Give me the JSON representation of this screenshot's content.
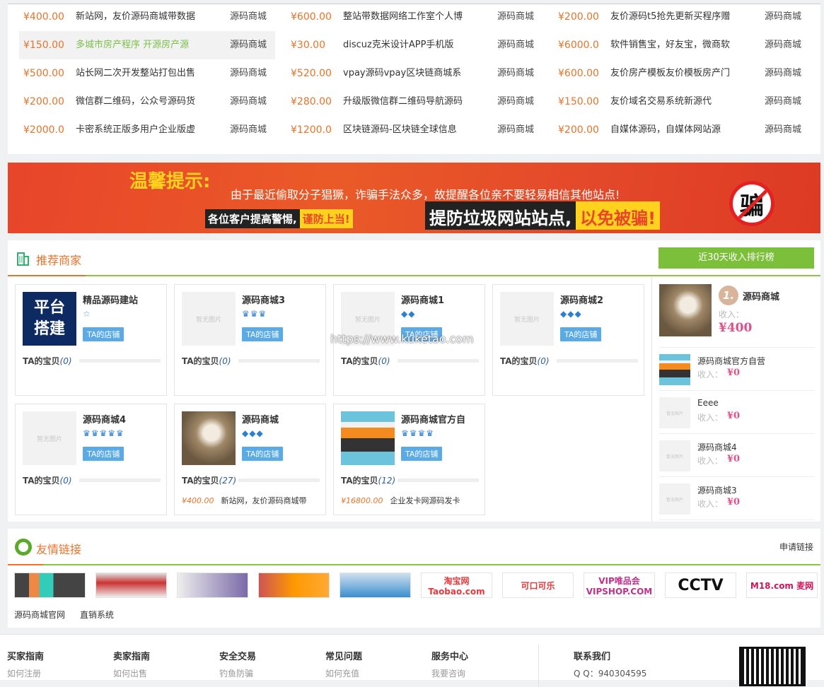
{
  "toplist": {
    "columns": [
      [
        {
          "price": "¥400.00",
          "title": "新站网，友价源码商城带数据",
          "shop": "源码商城"
        },
        {
          "price": "¥150.00",
          "title": "多城市房产程序 开源房产源",
          "shop": "源码商城",
          "highlight": true
        },
        {
          "price": "¥500.00",
          "title": "站长网二次开发整站打包出售",
          "shop": "源码商城"
        },
        {
          "price": "¥200.00",
          "title": "微信群二维码，公众号源码货",
          "shop": "源码商城"
        },
        {
          "price": "¥2000.0",
          "title": "卡密系统正版多用户企业版虚",
          "shop": "源码商城"
        }
      ],
      [
        {
          "price": "¥600.00",
          "title": "整站带数据网络工作室个人博",
          "shop": "源码商城"
        },
        {
          "price": "¥30.00",
          "title": "discuz克米设计APP手机版",
          "shop": "源码商城"
        },
        {
          "price": "¥520.00",
          "title": "vpay源码vpay区块链商城系",
          "shop": "源码商城"
        },
        {
          "price": "¥280.00",
          "title": "升级版微信群二维码导航源码",
          "shop": "源码商城"
        },
        {
          "price": "¥1200.0",
          "title": "区块链源码-区块链全球信息",
          "shop": "源码商城"
        }
      ],
      [
        {
          "price": "¥200.00",
          "title": "友价源码t5抢先更新买程序赠",
          "shop": "源码商城"
        },
        {
          "price": "¥6000.0",
          "title": "软件销售宝，好友宝，微商软",
          "shop": "源码商城"
        },
        {
          "price": "¥600.00",
          "title": "友价房产模板友价模板房产门",
          "shop": "源码商城"
        },
        {
          "price": "¥150.00",
          "title": "友价域名交易系统新源代",
          "shop": "源码商城"
        },
        {
          "price": "¥200.00",
          "title": "自媒体源码，自媒体网站源",
          "shop": "源码商城"
        }
      ]
    ]
  },
  "banner": {
    "heading": "温馨提示:",
    "line1": "由于最近偷取分子猖獗，诈骗手法众多，故提醒各位亲不要轻易相信其他站点!",
    "badge1_a": "各位客户提高警惕,",
    "badge1_b": "谨防上当!",
    "badge2_a": "提防垃圾网站站点,",
    "badge2_b": "以免被骗!",
    "icon_text": "骗"
  },
  "recommend": {
    "title": "推荐商家",
    "ranking_button": "近30天收入排行榜",
    "watermark": "https://www.kuketao.com",
    "cards": [
      {
        "name": "精品源码建站",
        "rank": "☆",
        "shop_btn": "TA的店铺",
        "goods_label": "TA的宝贝",
        "goods_count": "(0)",
        "thumb": "platform",
        "thumb_text": "平台搭建"
      },
      {
        "name": "源码商城3",
        "rank": "♛♛♛",
        "shop_btn": "TA的店铺",
        "goods_label": "TA的宝贝",
        "goods_count": "(0)",
        "thumb_text": "暂无图片"
      },
      {
        "name": "源码商城1",
        "rank": "◆◆",
        "shop_btn": "TA的店铺",
        "goods_label": "TA的宝贝",
        "goods_count": "(0)",
        "thumb_text": "暂无图片"
      },
      {
        "name": "源码商城2",
        "rank": "◆◆◆",
        "shop_btn": "TA的店铺",
        "goods_label": "TA的宝贝",
        "goods_count": "(0)",
        "thumb_text": "暂无图片"
      },
      {
        "name": "源码商城4",
        "rank": "♛♛♛♛♛",
        "shop_btn": "TA的店铺",
        "goods_label": "TA的宝贝",
        "goods_count": "(0)",
        "thumb_text": "暂无图片"
      },
      {
        "name": "源码商城",
        "rank": "◆◆◆",
        "shop_btn": "TA的店铺",
        "goods_label": "TA的宝贝",
        "goods_count": "(27)",
        "thumb": "photo",
        "item_price": "¥400.00",
        "item_title": "新站网，友价源码商城带"
      },
      {
        "name": "源码商城官方自",
        "rank": "♛♛♛♛",
        "shop_btn": "TA的店铺",
        "goods_label": "TA的宝贝",
        "goods_count": "(12)",
        "thumb": "screen",
        "item_price": "¥16800.00",
        "item_title": "企业发卡网源码发卡"
      }
    ],
    "ranking": [
      {
        "rank": "1.",
        "name": "源码商城",
        "income_label": "收入：",
        "income": "¥400",
        "thumb": "photo"
      },
      {
        "name": "源码商城官方自营",
        "income_label": "收入：",
        "income": "¥0",
        "thumb": "screen"
      },
      {
        "name": "Eeee",
        "income_label": "收入：",
        "income": "¥0",
        "thumb_text": "暂无图片"
      },
      {
        "name": "源码商城4",
        "income_label": "收入：",
        "income": "¥0",
        "thumb_text": "暂无图片"
      },
      {
        "name": "源码商城3",
        "income_label": "收入：",
        "income": "¥0",
        "thumb_text": "暂无图片"
      }
    ]
  },
  "links": {
    "title": "友情链接",
    "apply": "申请链接",
    "logos": [
      "淘宝网 Taobao.com",
      "可口可乐",
      "VIP唯品会 VIPSHOP.COM",
      "CCTV",
      "M18.com 麦网"
    ],
    "text_links": [
      "源码商城官网",
      "直销系统"
    ]
  },
  "footer": {
    "columns": [
      {
        "head": "买家指南",
        "link": "如何注册"
      },
      {
        "head": "卖家指南",
        "link": "如何出售"
      },
      {
        "head": "安全交易",
        "link": "钓鱼防骗"
      },
      {
        "head": "常见问题",
        "link": "如何充值"
      },
      {
        "head": "服务中心",
        "link": "我要咨询"
      }
    ],
    "contact_head": "联系我们",
    "qq": "Q Q：940304595"
  },
  "colors": {
    "accent": "#e8732a",
    "green": "#8bc34a",
    "pink": "#e0508a",
    "blue": "#5aaae6"
  }
}
